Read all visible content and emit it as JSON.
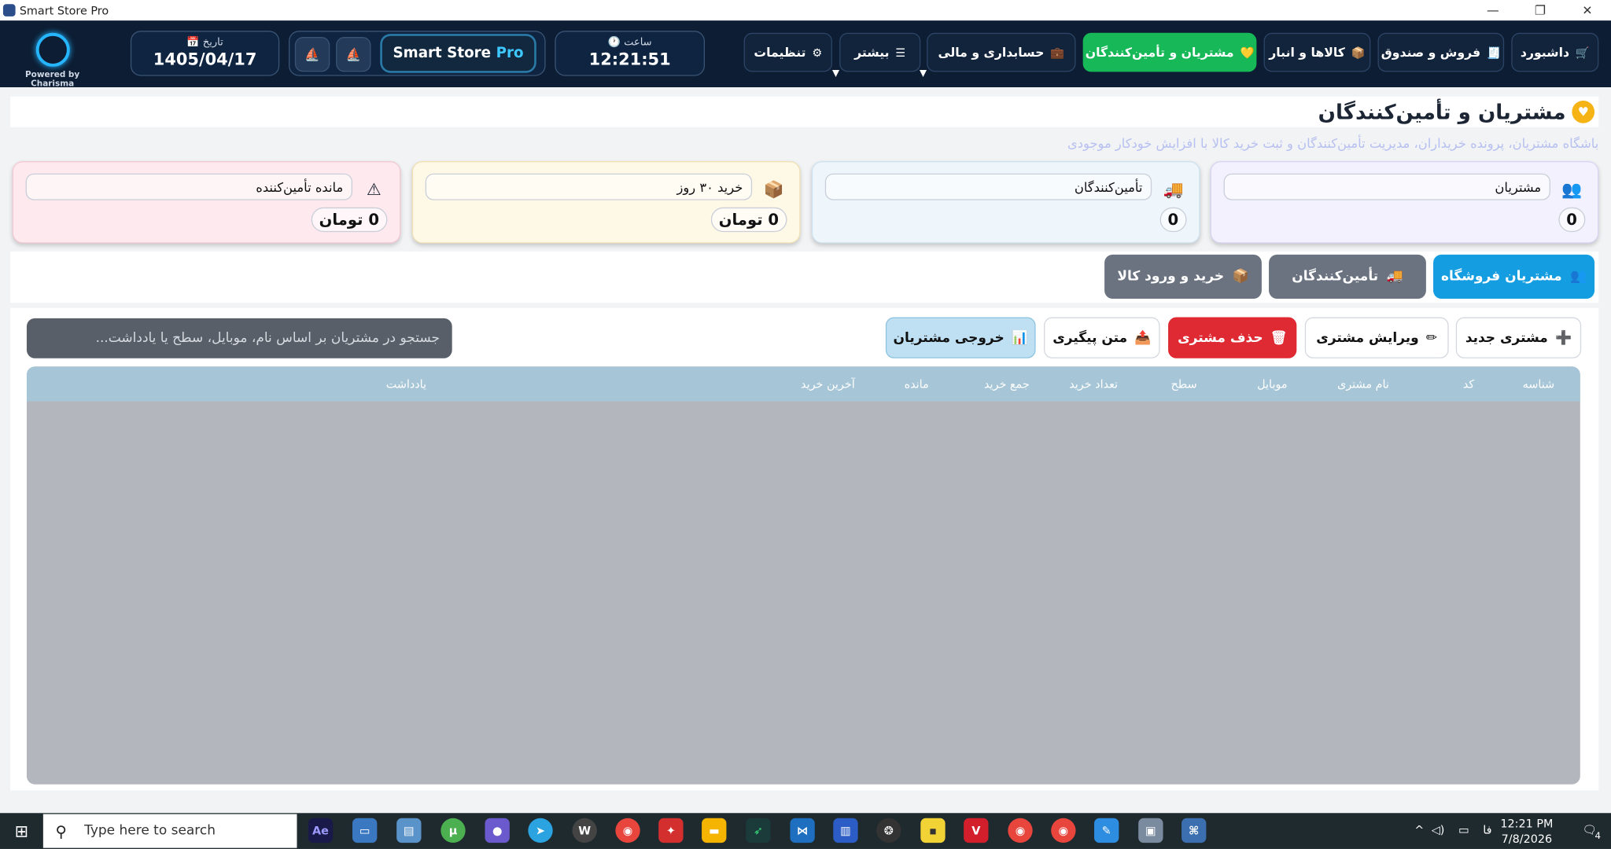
{
  "window": {
    "title": "Smart Store Pro",
    "controls": [
      "—",
      "❐",
      "✕"
    ]
  },
  "header": {
    "powered_by": "Powered by Charisma",
    "date_label": "تاریخ 📅",
    "date_value": "1405/04/17",
    "time_label": "ساعت 🕐",
    "time_value": "12:21:51",
    "brand_smart": "Smart Store",
    "brand_pro": "Pro",
    "nav": [
      {
        "label": "داشبورد",
        "icon": "🛒"
      },
      {
        "label": "فروش و صندوق",
        "icon": "🧾"
      },
      {
        "label": "کالاها و انبار",
        "icon": "📦"
      },
      {
        "label": "مشتریان و تأمین‌کنندگان",
        "icon": "💛"
      },
      {
        "label": "حسابداری و مالی",
        "icon": "💼"
      },
      {
        "label": "بیشتر",
        "icon": "☰"
      },
      {
        "label": "تنظیمات",
        "icon": "⚙"
      }
    ]
  },
  "page": {
    "title": "مشتریان و تأمین‌کنندگان",
    "subtitle": "باشگاه مشتریان، پرونده خریداران، مدیریت تأمین‌کنندگان و ثبت خرید کالا با افزایش خودکار موجودی"
  },
  "cards": [
    {
      "label": "مشتریان",
      "value": "0",
      "icon": "👥"
    },
    {
      "label": "تأمین‌کنندگان",
      "value": "0",
      "icon": "🚚"
    },
    {
      "label": "خرید ۳۰ روز",
      "value": "0 تومان",
      "icon": "📦"
    },
    {
      "label": "مانده تأمین‌کننده",
      "value": "0 تومان",
      "icon": "⚠"
    }
  ],
  "tabs": [
    {
      "label": "مشتریان فروشگاه",
      "icon": "👥"
    },
    {
      "label": "تأمین‌کنندگان",
      "icon": "🚚"
    },
    {
      "label": "خرید و ورود کالا",
      "icon": "📦"
    }
  ],
  "toolbar": {
    "new_customer": "مشتری جدید",
    "edit_customer": "ویرایش مشتری",
    "delete_customer": "حذف مشتری",
    "followup_text": "متن پیگیری",
    "export_customers": "خروجی مشتریان"
  },
  "search": {
    "placeholder": "جستجو در مشتریان بر اساس نام، موبایل، سطح یا یادداشت..."
  },
  "table": {
    "columns": [
      "شناسه",
      "کد",
      "نام مشتری",
      "موبایل",
      "سطح",
      "تعداد خرید",
      "جمع خرید",
      "مانده",
      "آخرین خرید",
      "یادداشت"
    ],
    "rows": []
  },
  "taskbar": {
    "search_placeholder": "Type here to search",
    "time": "12:21 PM",
    "date": "7/8/2026",
    "lang": "فا",
    "notifications": "4",
    "apps": [
      "Ae",
      "W",
      "V"
    ]
  },
  "colors": {
    "header_bg": "#0d1d33",
    "active_nav": "#16b857",
    "active_tab": "#149de0",
    "danger": "#df2a33"
  }
}
